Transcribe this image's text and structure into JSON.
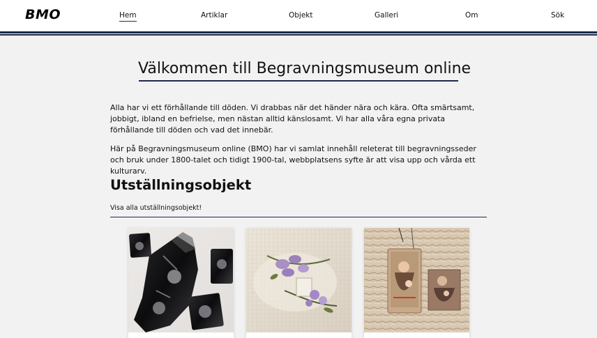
{
  "header": {
    "logo": "BMO",
    "nav": [
      {
        "label": "Hem",
        "active": true
      },
      {
        "label": "Artiklar",
        "active": false
      },
      {
        "label": "Objekt",
        "active": false
      },
      {
        "label": "Galleri",
        "active": false
      },
      {
        "label": "Om",
        "active": false
      },
      {
        "label": "Sök",
        "active": false
      }
    ]
  },
  "main": {
    "title": "Välkommen till Begravningsmuseum online",
    "paragraphs": [
      "Alla har vi ett förhållande till döden. Vi drabbas när det händer nära och kära. Ofta smärtsamt, jobbigt, ibland en befrielse, men nästan alltid känslosamt. Vi har alla våra egna privata förhållande till döden och vad det innebär.",
      "Här på Begravningsmuseum online (BMO) har vi samlat innehåll releterat till begravningsseder och bruk under 1800-talet och tidigt 1900-tal, webbplatsens syfte är att visa upp och vårda ett kulturarv."
    ],
    "exhibit_section": {
      "title": "Utställningsobjekt",
      "view_all_link": "Visa alla utställningsobjekt!"
    }
  },
  "colors": {
    "accent": "#1c2b4a",
    "background": "#f2f2f2"
  }
}
